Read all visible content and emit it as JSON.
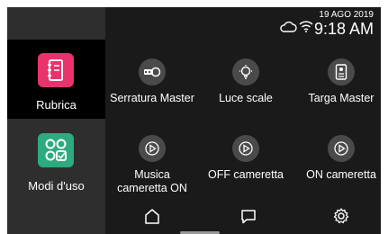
{
  "status": {
    "date": "19 AGO 2019",
    "time": "9:18 AM",
    "cloud_icon": "cloud-icon",
    "wifi_icon": "wifi-icon"
  },
  "sidebar": {
    "items": [
      {
        "label": "Rubrica",
        "icon": "address-book-icon",
        "color": "#e8336d",
        "selected": true
      },
      {
        "label": "Modi d'uso",
        "icon": "usage-modes-icon",
        "color": "#2eaa7f",
        "selected": false
      }
    ]
  },
  "tiles": [
    {
      "label": "Serratura Master",
      "icon": "key-lock-icon"
    },
    {
      "label": "Luce scale",
      "icon": "lightbulb-icon"
    },
    {
      "label": "Targa Master",
      "icon": "entry-panel-icon"
    },
    {
      "label": "Musica cameretta ON",
      "icon": "play-icon"
    },
    {
      "label": "OFF cameretta",
      "icon": "play-icon"
    },
    {
      "label": "ON cameretta",
      "icon": "play-icon"
    }
  ],
  "nav": {
    "home_icon": "home-icon",
    "chat_icon": "chat-icon",
    "settings_icon": "settings-icon"
  },
  "colors": {
    "background": "#1a1a1a",
    "sidebar": "#2e2e2e",
    "selected": "#000000",
    "tile_icon_bg": "#4a4a4a"
  }
}
